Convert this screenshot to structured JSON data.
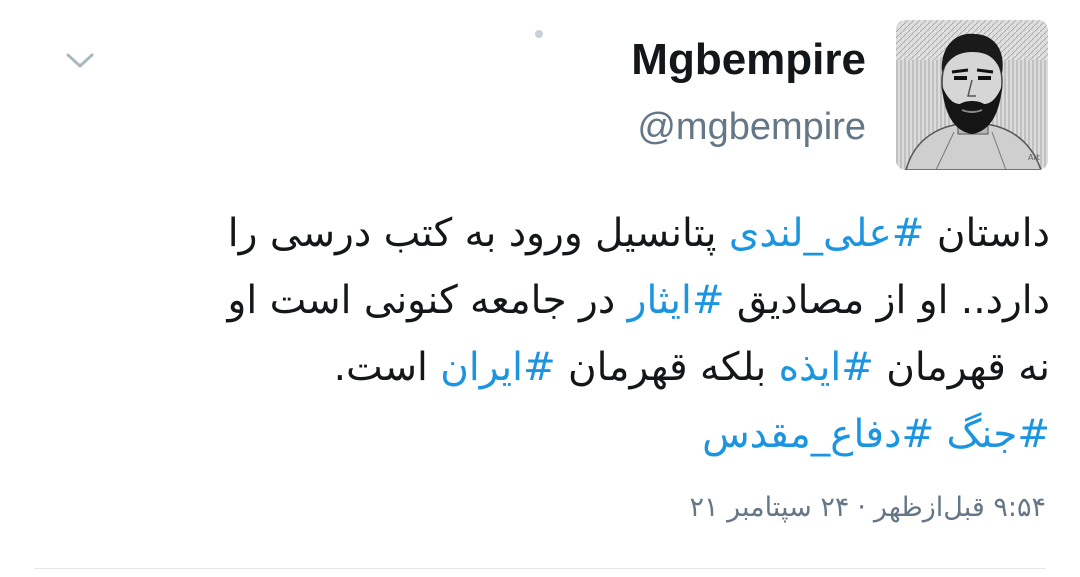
{
  "tweet": {
    "display_name": "Mgbempire",
    "username": "@mgbempire",
    "avatar_icon": "user-avatar-portrait",
    "menu_icon": "chevron-down-icon",
    "lines": [
      [
        {
          "text": "داستان ",
          "tag": false
        },
        {
          "text": "#علی_لندی",
          "tag": true
        },
        {
          "text": "  پتانسیل ورود به کتب درسی را",
          "tag": false
        }
      ],
      [
        {
          "text": "دارد.. او از مصادیق ",
          "tag": false
        },
        {
          "text": "#ایثار",
          "tag": true
        },
        {
          "text": " در جامعه کنونی است او",
          "tag": false
        }
      ],
      [
        {
          "text": "نه قهرمان ",
          "tag": false
        },
        {
          "text": "#ایذه",
          "tag": true
        },
        {
          "text": " بلکه قهرمان ",
          "tag": false
        },
        {
          "text": "#ایران",
          "tag": true
        },
        {
          "text": " است.",
          "tag": false
        }
      ],
      [
        {
          "text": "#جنگ",
          "tag": true
        },
        {
          "text": " ",
          "tag": false
        },
        {
          "text": "#دفاع_مقدس",
          "tag": true
        }
      ]
    ],
    "time": "۹:۵۴ قبل‌ازظهر",
    "separator": "·",
    "date": "۲۴ سپتامبر ۲۱"
  },
  "colors": {
    "text": "#14171a",
    "secondary": "#657786",
    "hashtag": "#1b95e0",
    "divider": "#e1e8ed"
  }
}
